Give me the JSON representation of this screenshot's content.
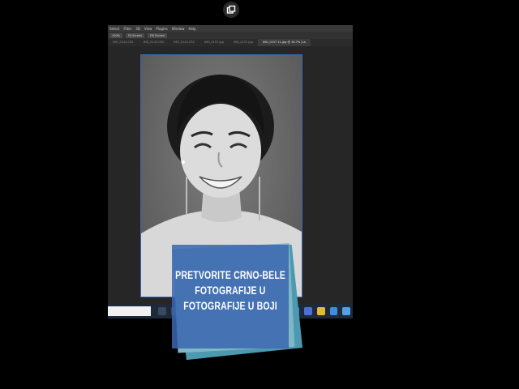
{
  "overlay": {
    "icon": "restore-window-icon"
  },
  "menubar": {
    "items": [
      "Select",
      "Filter",
      "3D",
      "View",
      "Plugins",
      "Window",
      "Help"
    ]
  },
  "optionsbar": {
    "buttons": [
      "100%",
      "Fit Screen",
      "Fill Screen"
    ]
  },
  "tabs": [
    {
      "label": "IMG_0142.CR2",
      "active": false
    },
    {
      "label": "IMG_0143.CR2",
      "active": false
    },
    {
      "label": "IMG_0144.CR2",
      "active": false
    },
    {
      "label": "IMG_0157.jpg",
      "active": false
    },
    {
      "label": "IMG_0157.jpg",
      "active": false
    },
    {
      "label": "IMG_0157 11.jpg @ 16.7% (La",
      "active": true
    }
  ],
  "photo": {
    "description_hidden": ""
  },
  "promo": {
    "lines": [
      "PRETVORITE CRNO-BELE",
      "FOTOGRAFIJE U",
      "FOTOGRAFIJE U BOJI"
    ],
    "colors": {
      "front": "#3a66b0",
      "back1": "#4d9ab0",
      "back2": "#7fb7c6"
    }
  },
  "taskbar": {
    "icons": [
      "search-icon",
      "task-view-icon",
      "photoshop-icon",
      "photoshop-icon",
      "chrome-icon",
      "folder-icon",
      "edge-icon",
      "settings-icon"
    ]
  }
}
